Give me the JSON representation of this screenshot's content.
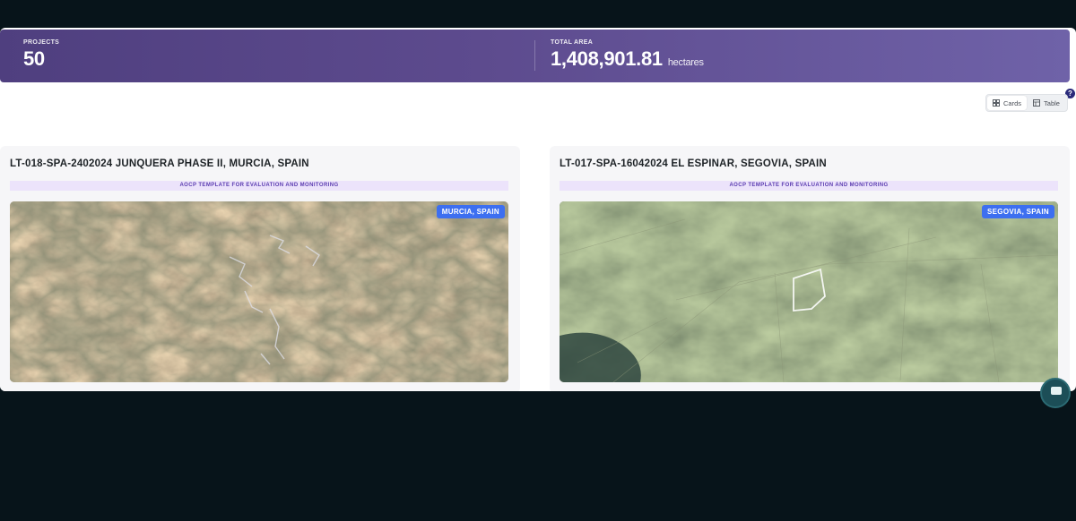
{
  "stats": {
    "projects_label": "PROJECTS",
    "projects_value": "50",
    "area_label": "TOTAL AREA",
    "area_value": "1,408,901.81",
    "area_unit": "hectares"
  },
  "help": {
    "icon": "question-icon",
    "label": "?"
  },
  "view_toggle": {
    "options": [
      {
        "label": "Cards",
        "icon": "grid-icon",
        "active": true
      },
      {
        "label": "Table",
        "icon": "table-icon",
        "active": false
      }
    ]
  },
  "projects": [
    {
      "title": "LT-018-SPA-2402024 JUNQUERA PHASE II, MURCIA, SPAIN",
      "template": "AOCP TEMPLATE FOR EVALUATION AND MONITORING",
      "location": "MURCIA, SPAIN"
    },
    {
      "title": "LT-017-SPA-16042024 EL ESPINAR, SEGOVIA, SPAIN",
      "template": "AOCP TEMPLATE FOR EVALUATION AND MONITORING",
      "location": "SEGOVIA, SPAIN"
    }
  ],
  "colors": {
    "stats_gradient_start": "#4f3f7f",
    "stats_gradient_end": "#6f62a8",
    "badge": "#3d6ff0",
    "template_text": "#5a3bb0",
    "template_bg": "#ece3fb"
  }
}
